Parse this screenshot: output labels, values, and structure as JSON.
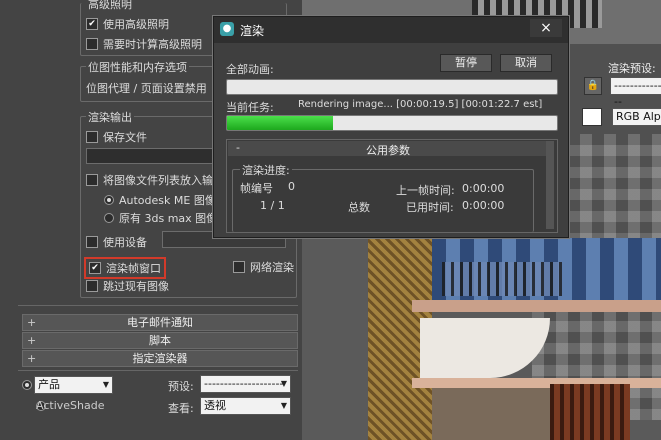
{
  "left_panel": {
    "advanced_lighting_group": "高级照明",
    "use_advanced_lighting": "使用高级照明",
    "compute_advanced_lighting": "需要时计算高级照明",
    "bitmap_group": "位图性能和内存选项",
    "bitmap_text": "位图代理 / 页面设置禁用",
    "render_output_group": "渲染输出",
    "save_file": "保存文件",
    "put_into_list": "将图像文件列表放入输",
    "autodesk_me": "Autodesk ME 图像序",
    "legacy_3dsmax": "原有 3ds max 图像文",
    "use_device": "使用设备",
    "rendered_frame_window": "渲染帧窗口",
    "net_render": "网络渲染",
    "skip_existing": "跳过现有图像",
    "rollouts": [
      "电子邮件通知",
      "脚本",
      "指定渲染器"
    ],
    "product_label": "产品",
    "activeshade_label": "ActiveShade",
    "preset_label": "预设:",
    "preset_value": "--------------------",
    "view_label": "查看:",
    "view_value": "透视"
  },
  "viewport_ui": {
    "render_preset_label": "渲染预设:",
    "render_preset_value": "--------------",
    "channel_value": "RGB Alpha"
  },
  "render_dialog": {
    "title": "渲染",
    "close": "×",
    "total_animation": "全部动画:",
    "pause": "暂停",
    "cancel": "取消",
    "current_task": "当前任务:",
    "task_text": "Rendering image... [00:00:19.5] [00:01:22.7 est]",
    "current_progress": 0.32,
    "common_params": "公用参数",
    "minus": "-",
    "render_progress": "渲染进度:",
    "frame_no": "帧编号",
    "frame_no_value": "0",
    "last_frame_time": "上一帧时间:",
    "last_frame_value": "0:00:00",
    "frame_count": "1 / 1",
    "total": "总数",
    "elapsed": "已用时间:",
    "elapsed_value": "0:00:00"
  }
}
